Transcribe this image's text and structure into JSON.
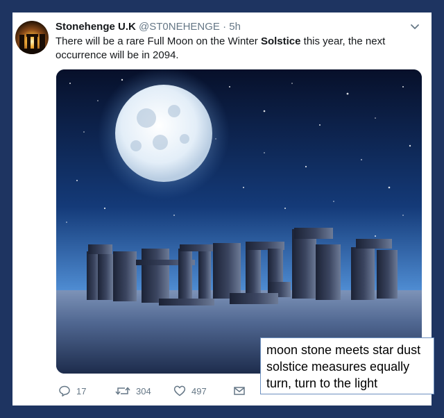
{
  "tweet": {
    "author_name": "Stonehenge U.K",
    "handle": "@ST0NEHENGE",
    "separator": "·",
    "time": "5h",
    "text_part1": "There will be a rare Full Moon on the Winter ",
    "text_bold": "Solstice",
    "text_part2": " this year, the next occurrence will be in 2094.",
    "menu_icon": "chevron-down-icon",
    "avatar_icon": "stonehenge-sunset-avatar"
  },
  "media": {
    "subject": "full-moon-over-stonehenge-night-sky"
  },
  "actions": {
    "reply_count": "17",
    "retweet_count": "304",
    "like_count": "497",
    "icons": [
      "reply-icon",
      "retweet-icon",
      "like-icon",
      "dm-icon"
    ]
  },
  "overlay_poem": {
    "lines": [
      "moon stone meets star dust",
      "solstice measures equally",
      "turn, turn to the light"
    ]
  },
  "colors": {
    "background": "#1e3461",
    "card": "#ffffff",
    "secondary_text": "#657786",
    "primary_text": "#14171a",
    "poem_border": "#6b8fbf"
  }
}
